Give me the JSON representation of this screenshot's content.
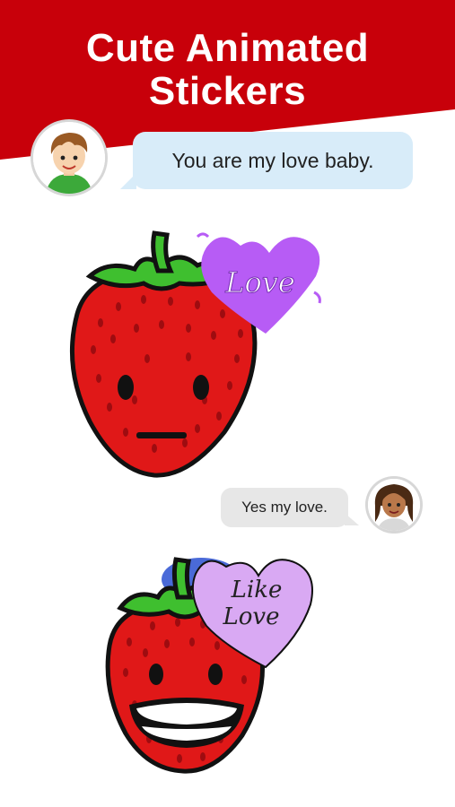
{
  "header": {
    "title_line1": "Cute Animated",
    "title_line2": "Stickers"
  },
  "colors": {
    "banner_red": "#c8000a",
    "bubble_blue": "#d8ecf9",
    "bubble_grey": "#e7e7e7",
    "strawberry_red": "#e01818",
    "leaf_green": "#3fbf2f",
    "heart_purple": "#b75cf5",
    "heart_lilac": "#d9a9f3"
  },
  "chat": {
    "messages": [
      {
        "sender": "boy",
        "text": "You are my love baby."
      },
      {
        "sender": "girl",
        "text": "Yes my love."
      }
    ]
  },
  "stickers": {
    "love": {
      "heart_text": "Love",
      "icon": "strawberry-neutral-icon"
    },
    "like_love": {
      "heart_line1": "Like",
      "heart_line2": "Love",
      "icon": "strawberry-smiling-icon"
    }
  }
}
